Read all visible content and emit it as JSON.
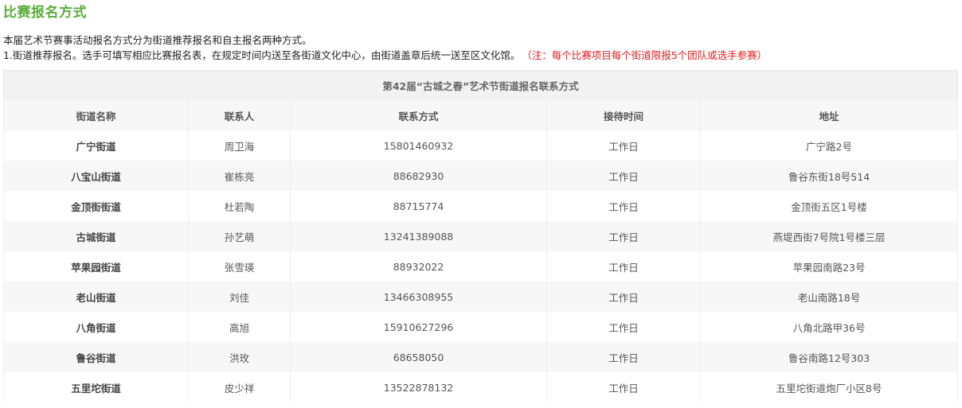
{
  "section_title": "比赛报名方式",
  "intro": {
    "line1": "本届艺术节赛事活动报名方式分为街道推荐报名和自主报名两种方式。",
    "line2": "1.街道推荐报名。选手可填写相应比赛报名表，在规定时间内送至各街道文化中心，由街道盖章后统一送至区文化馆。",
    "note": "（注：每个比赛项目每个街道限报5个团队或选手参赛）"
  },
  "table": {
    "caption": "第42届“古城之春”艺术节街道报名联系方式",
    "headers": [
      "街道名称",
      "联系人",
      "联系方式",
      "接待时间",
      "地址"
    ],
    "rows": [
      [
        "广宁街道",
        "周卫海",
        "15801460932",
        "工作日",
        "广宁路2号"
      ],
      [
        "八宝山街道",
        "崔栋亮",
        "88682930",
        "工作日",
        "鲁谷东街18号514"
      ],
      [
        "金顶街街道",
        "杜若陶",
        "88715774",
        "工作日",
        "金顶街五区1号楼"
      ],
      [
        "古城街道",
        "孙艺萌",
        "13241389088",
        "工作日",
        "燕堤西街7号院1号楼三层"
      ],
      [
        "苹果园街道",
        "张雪瑛",
        "88932022",
        "工作日",
        "苹果园南路23号"
      ],
      [
        "老山街道",
        "刘佳",
        "13466308955",
        "工作日",
        "老山南路18号"
      ],
      [
        "八角街道",
        "高旭",
        "15910627296",
        "工作日",
        "八角北路甲36号"
      ],
      [
        "鲁谷街道",
        "洪玫",
        "68658050",
        "工作日",
        "鲁谷南路12号303"
      ],
      [
        "五里坨街道",
        "皮少祥",
        "13522878132",
        "工作日",
        "五里坨街道炮厂小区8号"
      ]
    ]
  },
  "colors": {
    "title_green": "#5aad3a",
    "note_red": "#e02020"
  }
}
